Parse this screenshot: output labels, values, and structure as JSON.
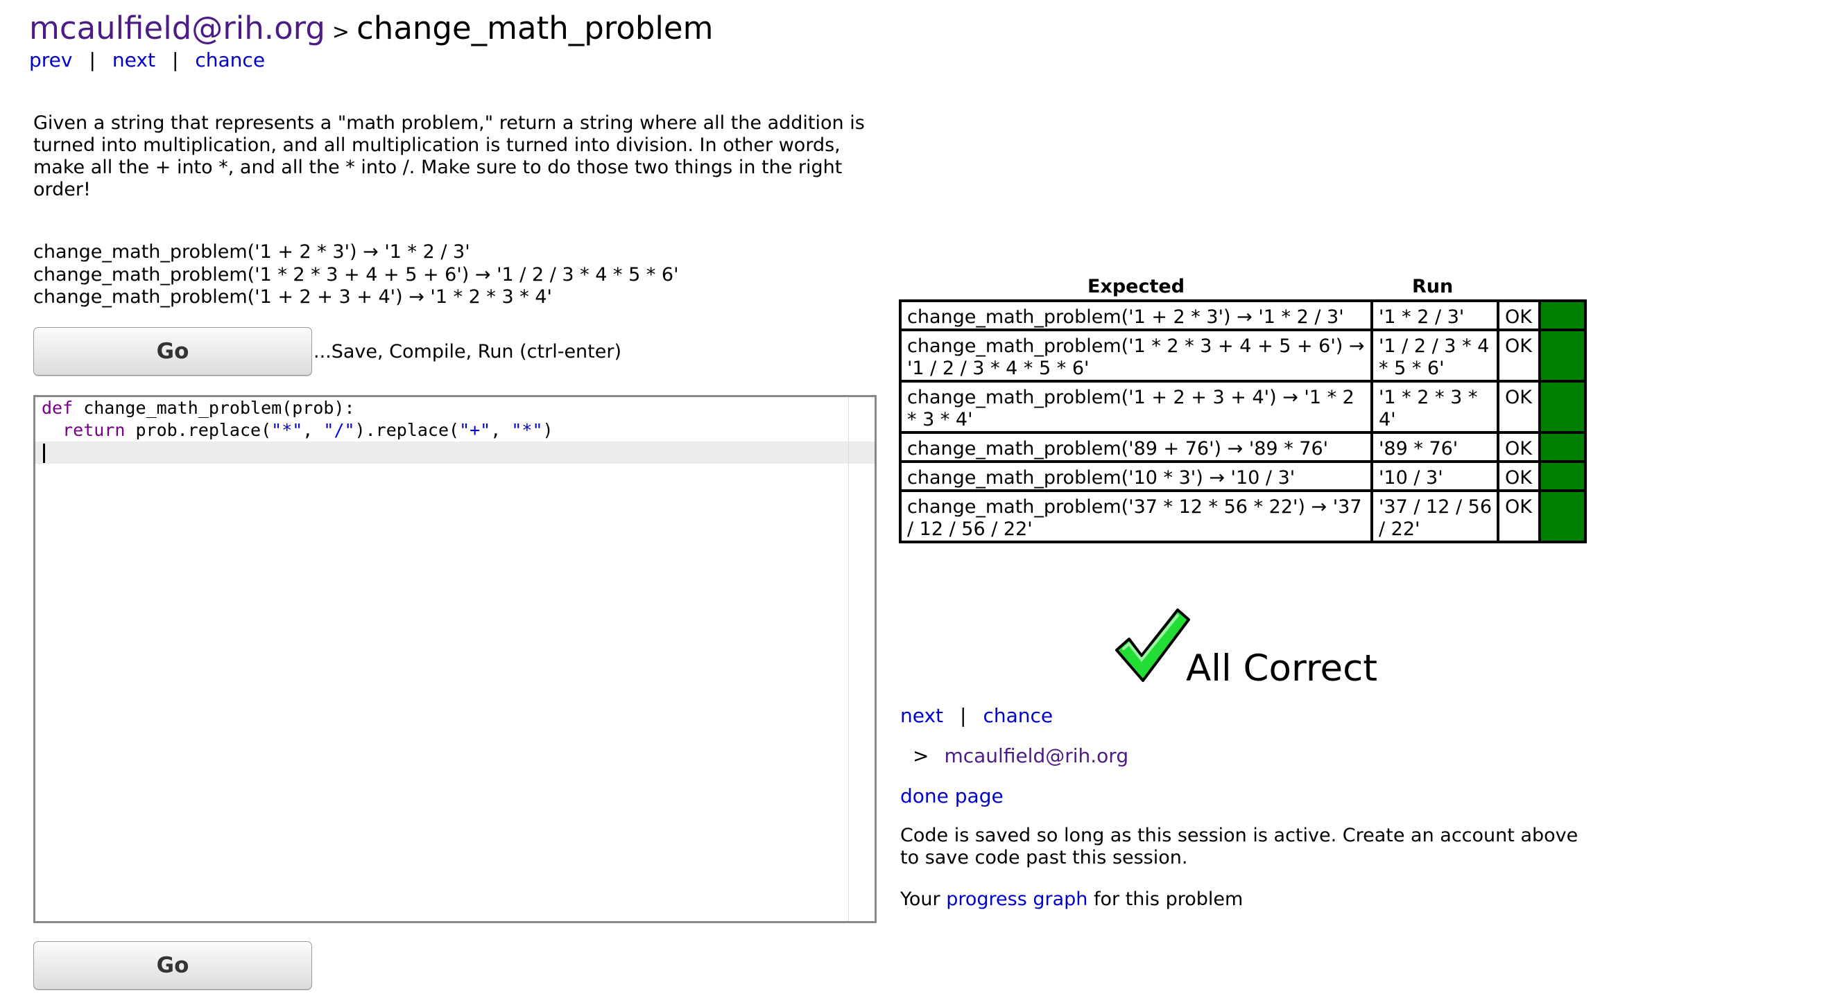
{
  "header": {
    "user": "mcaulfield@rih.org",
    "separator": ">",
    "problem_name": "change_math_problem"
  },
  "nav_top": {
    "prev": "prev",
    "next": "next",
    "chance": "chance",
    "divider": "|"
  },
  "description": "Given a string that represents a \"math problem,\" return a string where all the addition is turned into multiplication, and all multiplication is turned into division. In other words, make all the + into *, and all the * into /. Make sure to do those two things in the right order!",
  "examples": [
    "change_math_problem('1 + 2 * 3') → '1 * 2 / 3'",
    "change_math_problem('1 * 2 * 3 + 4 + 5 + 6') → '1 / 2 / 3 * 4 * 5 * 6'",
    "change_math_problem('1 + 2 + 3 + 4') → '1 * 2 * 3 * 4'"
  ],
  "go_button": {
    "label": "Go",
    "hint": "...Save, Compile, Run (ctrl-enter)"
  },
  "editor": {
    "line1_kw": "def",
    "line1_rest": " change_math_problem(prob):",
    "line2_indent": "  ",
    "line2_kw": "return",
    "line2_a": " prob.replace(",
    "line2_s1": "\"*\"",
    "line2_b": ", ",
    "line2_s2": "\"/\"",
    "line2_c": ").replace(",
    "line2_s3": "\"+\"",
    "line2_d": ", ",
    "line2_s4": "\"*\"",
    "line2_e": ")"
  },
  "results": {
    "header_expected": "Expected",
    "header_run": "Run",
    "rows": [
      {
        "expected": "change_math_problem('1 + 2 * 3') → '1 * 2 / 3'",
        "run": "'1 * 2 / 3'",
        "status": "OK"
      },
      {
        "expected": "change_math_problem('1 * 2 * 3 + 4 + 5 + 6') → '1 / 2 / 3 * 4 * 5 * 6'",
        "run": "'1 / 2 / 3 * 4 * 5 * 6'",
        "status": "OK"
      },
      {
        "expected": "change_math_problem('1 + 2 + 3 + 4') → '1 * 2 * 3 * 4'",
        "run": "'1 * 2 * 3 * 4'",
        "status": "OK"
      },
      {
        "expected": "change_math_problem('89 + 76') → '89 * 76'",
        "run": "'89 * 76'",
        "status": "OK"
      },
      {
        "expected": "change_math_problem('10 * 3') → '10 / 3'",
        "run": "'10 / 3'",
        "status": "OK"
      },
      {
        "expected": "change_math_problem('37 * 12 * 56 * 22') → '37 / 12 / 56 / 22'",
        "run": "'37 / 12 / 56 / 22'",
        "status": "OK"
      }
    ],
    "pass_color": "#008000"
  },
  "all_correct": {
    "icon": "checkmark-icon",
    "label": "All Correct"
  },
  "nav_bottom": {
    "next": "next",
    "chance": "chance",
    "divider": "|"
  },
  "user_row": {
    "arrow": ">",
    "user": "mcaulfield@rih.org"
  },
  "done_page": "done page",
  "save_note": "Code is saved so long as this session is active. Create an account above to save code past this session.",
  "progress": {
    "prefix": "Your",
    "link": "progress graph",
    "suffix": "for this problem"
  }
}
